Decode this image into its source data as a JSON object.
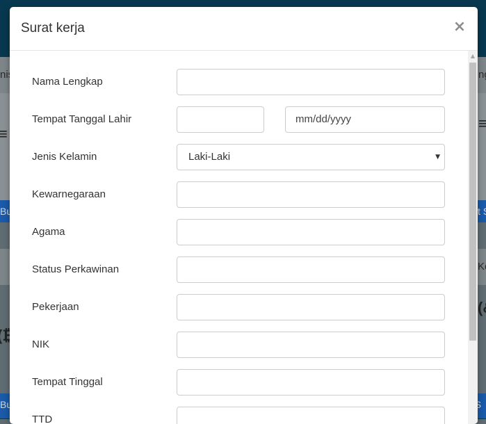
{
  "modal": {
    "title": "Surat kerja",
    "close_label": "×"
  },
  "form": {
    "fields": [
      {
        "label": "Nama Lengkap",
        "value": "",
        "placeholder": ""
      },
      {
        "label": "Tempat Tanggal Lahir",
        "place_value": "",
        "date_placeholder": "mm/dd/yyyy"
      },
      {
        "label": "Jenis Kelamin",
        "selected": "Laki-Laki"
      },
      {
        "label": "Kewarnegaraan",
        "value": ""
      },
      {
        "label": "Agama",
        "value": ""
      },
      {
        "label": "Status Perkawinan",
        "value": ""
      },
      {
        "label": "Pekerjaan",
        "value": ""
      },
      {
        "label": "NIK",
        "value": ""
      },
      {
        "label": "Tempat Tinggal",
        "value": ""
      },
      {
        "label": "TTD",
        "value": ""
      }
    ]
  },
  "background": {
    "nav_left": "nis",
    "nav_right": "ng",
    "button_left": "Bu",
    "button_right": "t S",
    "band_right": "Ke",
    "bottom_left": "Bu",
    "bottom_right": "t S"
  },
  "icons": {
    "close": "close-icon",
    "select_caret": "caret-down-icon",
    "scroll_up": "scroll-up-arrow-icon"
  },
  "colors": {
    "header_dark": "#08384f",
    "button_blue": "#1a5aa8",
    "overlay": "#5f6c72"
  }
}
